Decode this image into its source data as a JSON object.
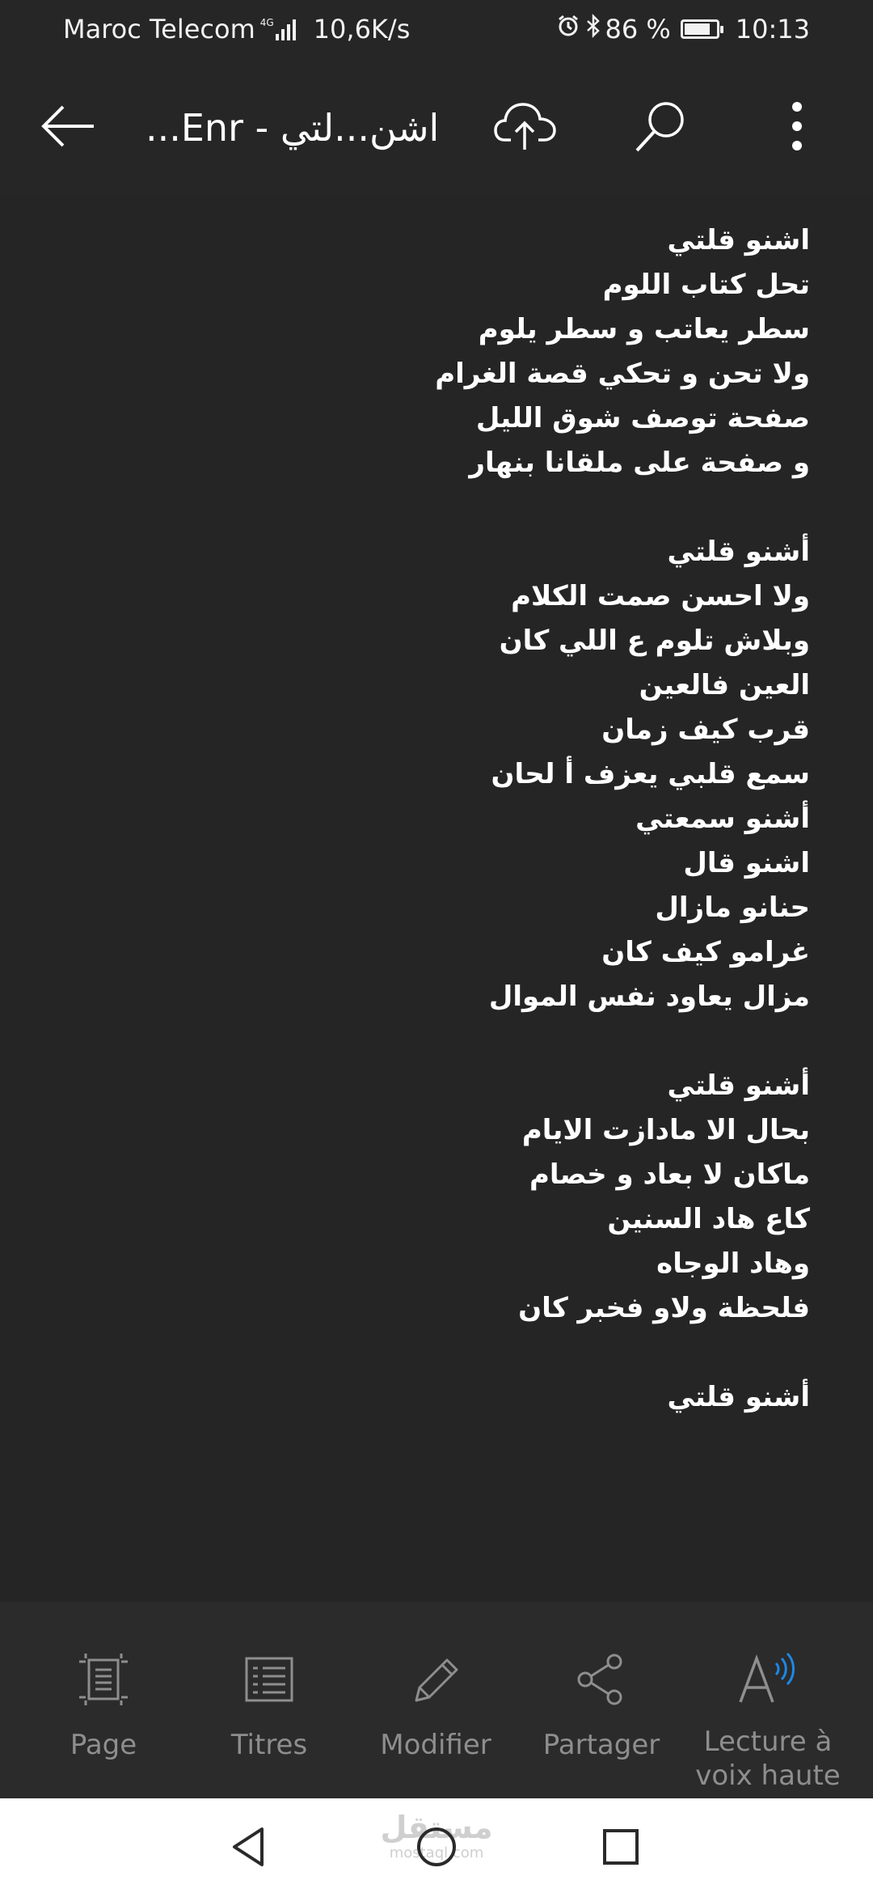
{
  "status_bar": {
    "carrier": "Maroc Telecom",
    "network": "4G",
    "speed": "10,6K/s",
    "battery": "86 %",
    "battery_level": 0.86,
    "time": "10:13",
    "icons": [
      "alarm-icon",
      "bluetooth-icon",
      "battery-icon",
      "signal-icon"
    ]
  },
  "app_bar": {
    "title": "...Enr - اشن...لتي",
    "icons": [
      "back-arrow-icon",
      "cloud-upload-icon",
      "search-icon",
      "more-vertical-icon"
    ]
  },
  "document": {
    "stanzas": [
      [
        "اشنو قلتي",
        "تحل كتاب اللوم",
        "سطر يعاتب و سطر يلوم",
        "ولا تحن و تحكي قصة الغرام",
        "صفحة توصف شوق الليل",
        "و صفحة على ملقانا بنهار"
      ],
      [
        "أشنو قلتي",
        "ولا احسن صمت الكلام",
        "وبلاش تلوم ع اللي كان",
        "العين فالعين",
        "قرب كيف زمان",
        "سمع قلبي يعزف أ لحان",
        "أشنو سمعتي",
        "اشنو قال",
        "حنانو مازال",
        "غرامو كيف كان",
        "مزال يعاود نفس الموال"
      ],
      [
        "أشنو قلتي",
        "بحال الا مادازت الايام",
        "ماكان لا بعاد و خصام",
        "كاع هاد السنين",
        "وهاد الوجاه",
        "فلحظة ولاو فخبر كان"
      ],
      [
        "أشنو قلتي"
      ]
    ]
  },
  "toolbar": {
    "items": [
      {
        "label": "Page",
        "icon": "page-view-icon"
      },
      {
        "label": "Titres",
        "icon": "headings-list-icon"
      },
      {
        "label": "Modifier",
        "icon": "pencil-icon"
      },
      {
        "label": "Partager",
        "icon": "share-icon"
      },
      {
        "label": "Lecture à voix haute",
        "icon": "read-aloud-icon"
      }
    ]
  },
  "nav_bar": {
    "icons": [
      "nav-back-icon",
      "nav-home-icon",
      "nav-recents-icon"
    ],
    "watermark_ar": "مستقل",
    "watermark_en": "mostaql.com"
  },
  "colors": {
    "background": "#252525",
    "bar": "#262626",
    "toolbar": "#2b2b2b",
    "text": "#ffffff",
    "muted": "#8e8e8e",
    "accent": "#1e88e5"
  }
}
